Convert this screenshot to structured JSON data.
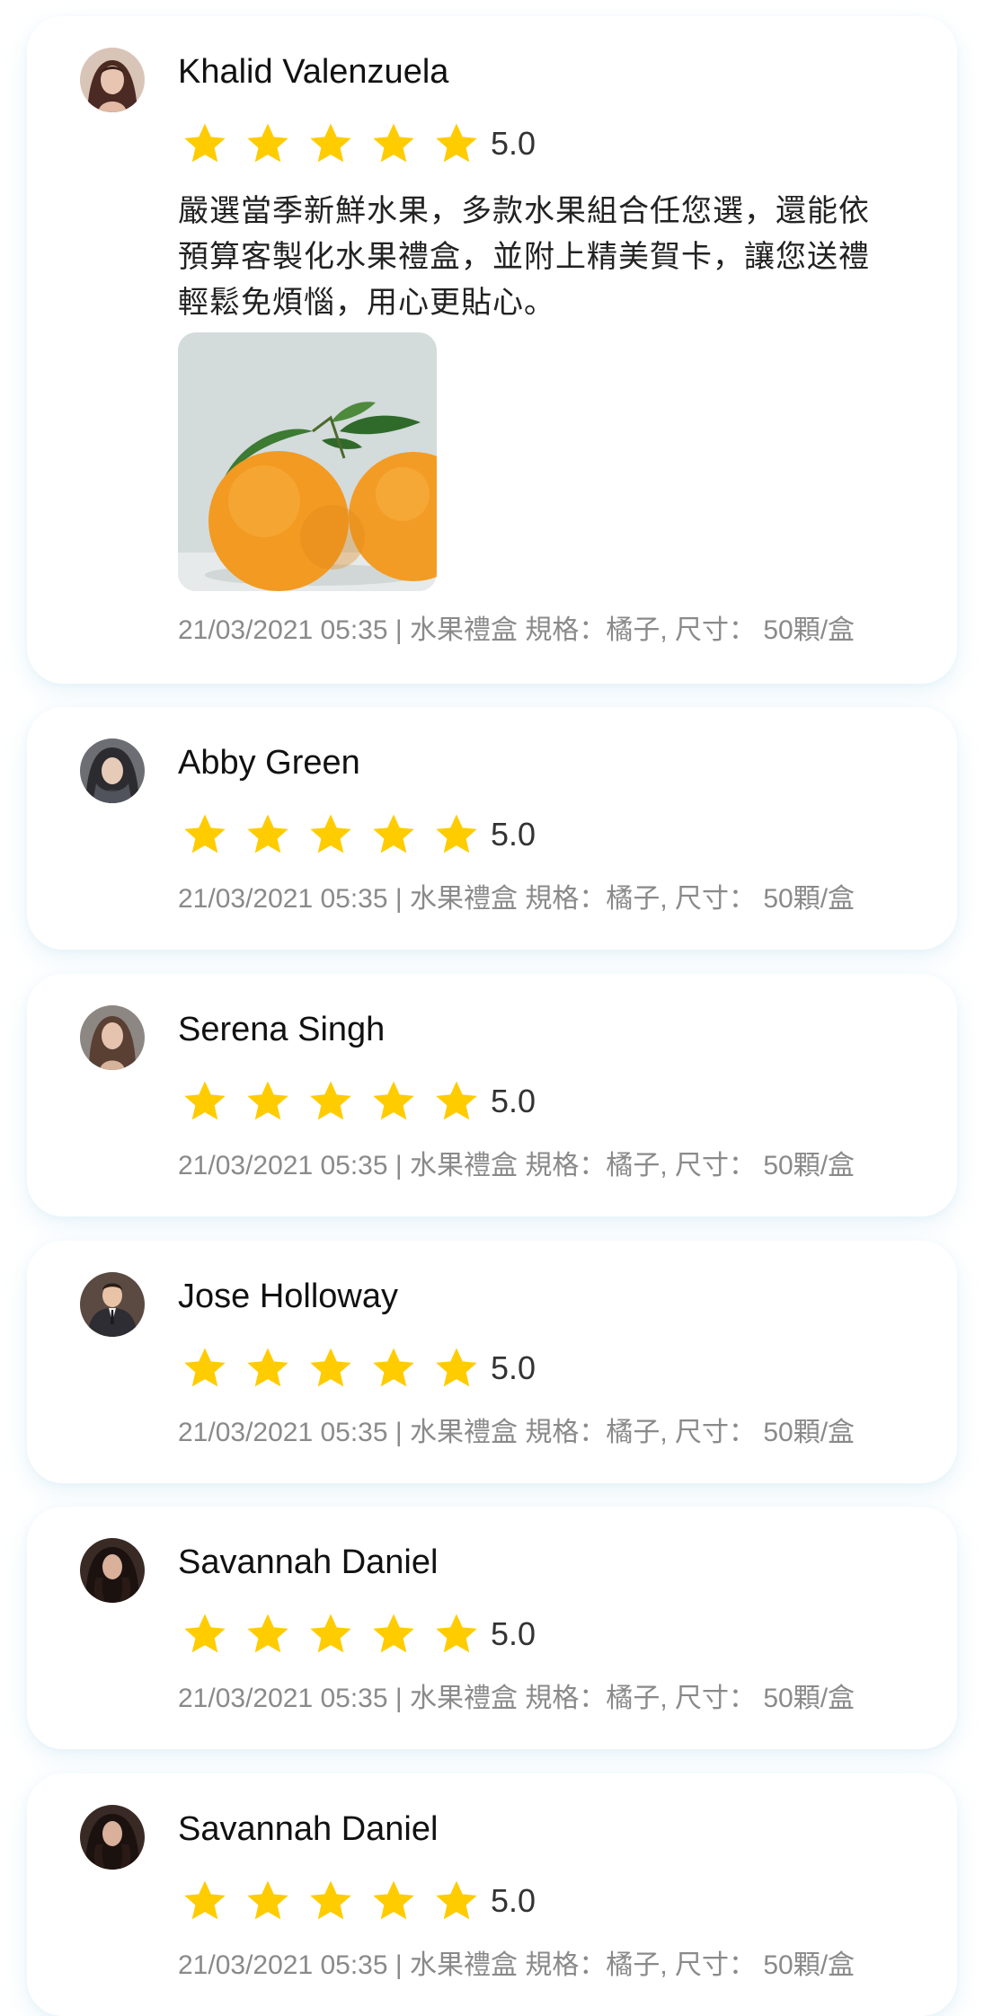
{
  "reviews": [
    {
      "name": "Khalid Valenzuela",
      "rating": 5,
      "score": "5.0",
      "text": "嚴選當季新鮮水果，多款水果組合任您選，還能依預算客製化水果禮盒，並附上精美賀卡，讓您送禮輕鬆免煩惱，用心更貼心。",
      "photo_icon": "orange-photo",
      "meta": "21/03/2021 05:35 | 水果禮盒 規格：橘子, 尺寸： 50顆/盒"
    },
    {
      "name": "Abby Green",
      "rating": 5,
      "score": "5.0",
      "meta": "21/03/2021 05:35 | 水果禮盒 規格：橘子, 尺寸： 50顆/盒"
    },
    {
      "name": "Serena Singh",
      "rating": 5,
      "score": "5.0",
      "meta": "21/03/2021 05:35 | 水果禮盒 規格：橘子, 尺寸： 50顆/盒"
    },
    {
      "name": "Jose Holloway",
      "rating": 5,
      "score": "5.0",
      "meta": "21/03/2021 05:35 | 水果禮盒 規格：橘子, 尺寸： 50顆/盒"
    },
    {
      "name": "Savannah Daniel",
      "rating": 5,
      "score": "5.0",
      "meta": "21/03/2021 05:35 | 水果禮盒 規格：橘子, 尺寸： 50顆/盒"
    },
    {
      "name": "Savannah Daniel",
      "rating": 5,
      "score": "5.0",
      "meta": "21/03/2021 05:35 | 水果禮盒 規格：橘子, 尺寸： 50顆/盒"
    }
  ],
  "colors": {
    "star": "#FFCC00",
    "meta_text": "#8a8a8a",
    "card_shadow": "#96CDE6"
  }
}
